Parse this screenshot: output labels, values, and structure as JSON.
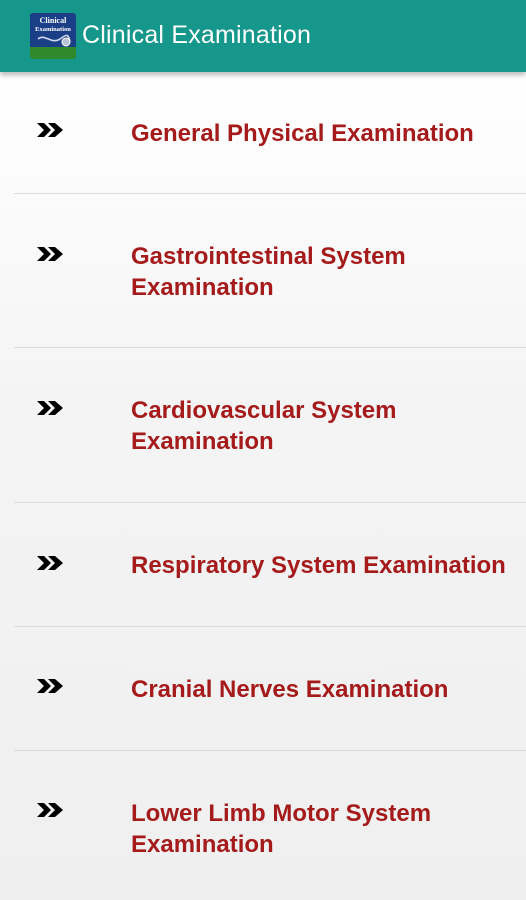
{
  "app": {
    "title": "Clinical Examination",
    "icon_name": "clinical-examination-app-icon",
    "icon_text_line1": "Clinical",
    "icon_text_line2": "Examination"
  },
  "colors": {
    "appbar": "#15988b",
    "label": "#a51b1b",
    "arrow": "#000000",
    "divider": "#dcdcdc"
  },
  "list": {
    "bullet_icon": "double-chevron-right-icon",
    "items": [
      {
        "label": "General Physical Examination"
      },
      {
        "label": "Gastrointestinal System Examination"
      },
      {
        "label": "Cardiovascular System Examination"
      },
      {
        "label": "Respiratory System Examination"
      },
      {
        "label": "Cranial Nerves Examination"
      },
      {
        "label": "Lower Limb Motor System Examination"
      }
    ]
  }
}
